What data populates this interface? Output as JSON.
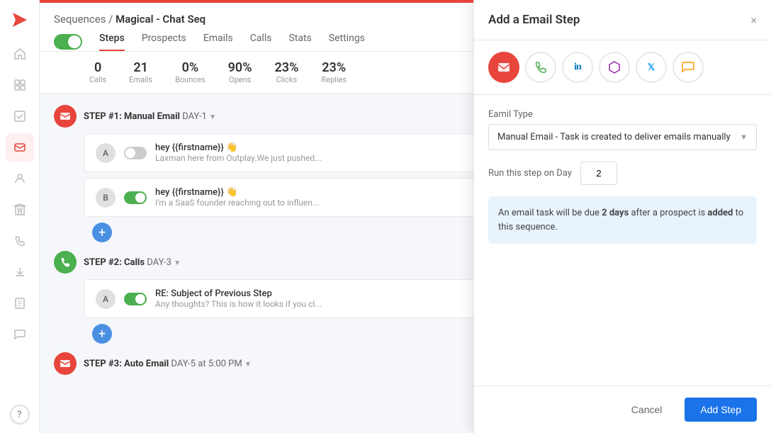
{
  "app": {
    "logo_symbol": "✈"
  },
  "sidebar": {
    "items": [
      {
        "id": "home",
        "icon": "⌂",
        "active": false
      },
      {
        "id": "dashboard",
        "icon": "▦",
        "active": false
      },
      {
        "id": "tasks",
        "icon": "☑",
        "active": false
      },
      {
        "id": "email",
        "icon": "✉",
        "active": true
      },
      {
        "id": "users",
        "icon": "👤",
        "active": false
      },
      {
        "id": "building",
        "icon": "🏢",
        "active": false
      },
      {
        "id": "phone",
        "icon": "☎",
        "active": false
      },
      {
        "id": "download",
        "icon": "⬇",
        "active": false
      },
      {
        "id": "document",
        "icon": "📄",
        "active": false
      },
      {
        "id": "chat",
        "icon": "💬",
        "active": false
      },
      {
        "id": "help",
        "icon": "?",
        "active": false
      }
    ]
  },
  "header": {
    "breadcrumb_prefix": "Sequences /",
    "breadcrumb_bold": "Magical - Chat Seq",
    "toggle_on": true
  },
  "tabs": [
    {
      "id": "steps",
      "label": "Steps",
      "active": true
    },
    {
      "id": "prospects",
      "label": "Prospects",
      "active": false
    },
    {
      "id": "emails",
      "label": "Emails",
      "active": false
    },
    {
      "id": "calls",
      "label": "Calls",
      "active": false
    },
    {
      "id": "stats",
      "label": "Stats",
      "active": false
    },
    {
      "id": "settings",
      "label": "Settings",
      "active": false
    }
  ],
  "stats": [
    {
      "value": "0",
      "label": "Calls"
    },
    {
      "value": "21",
      "label": "Emails"
    },
    {
      "value": "0%",
      "label": "Bounces"
    },
    {
      "value": "90%",
      "label": "Opens"
    },
    {
      "value": "23%",
      "label": "Clicks"
    },
    {
      "value": "23%",
      "label": "Replies"
    }
  ],
  "steps": [
    {
      "id": "step1",
      "label": "STEP #1:",
      "type": "Manual Email",
      "day": "DAY-1",
      "icon_type": "email",
      "emails": [
        {
          "id": "a",
          "avatar": "A",
          "toggle": "off",
          "subject": "hey {{firstname}} 👋",
          "preview": "Laxman here from Outplay.We just pushed..."
        },
        {
          "id": "b",
          "avatar": "B",
          "toggle": "on",
          "subject": "hey {{firstname}} 👋",
          "preview": "I'm a SaaS founder reaching out to influen..."
        }
      ]
    },
    {
      "id": "step2",
      "label": "STEP #2:",
      "type": "Calls",
      "day": "DAY-3",
      "icon_type": "calls",
      "emails": [
        {
          "id": "a",
          "avatar": "A",
          "toggle": "on",
          "subject": "RE: Subject of Previous Step",
          "preview": "Any thoughts? This is how it looks if you cl..."
        }
      ]
    },
    {
      "id": "step3",
      "label": "STEP #3:",
      "type": "Auto Email",
      "day": "DAY-5 at 5:00 PM",
      "icon_type": "email",
      "emails": []
    }
  ],
  "panel": {
    "title": "Add a Email Step",
    "close_icon": "×",
    "icons": [
      {
        "id": "email",
        "type": "red",
        "symbol": "✉"
      },
      {
        "id": "phone",
        "type": "green",
        "symbol": "☎"
      },
      {
        "id": "linkedin",
        "type": "linkedin",
        "symbol": "in"
      },
      {
        "id": "custom",
        "type": "purple",
        "symbol": "⬡"
      },
      {
        "id": "twitter",
        "type": "twitter",
        "symbol": "𝕏"
      },
      {
        "id": "message",
        "type": "yellow",
        "symbol": "💬"
      }
    ],
    "email_type_label": "Eamil Type",
    "email_type_value": "Manual Email - Task is created to deliver emails manually",
    "run_day_label": "Run this step on Day",
    "run_day_value": "2",
    "info_text_prefix": "An email task will be due ",
    "info_text_bold1": "2 days",
    "info_text_mid": " after a prospect is ",
    "info_text_bold2": "added",
    "info_text_suffix": " to this sequence.",
    "cancel_label": "Cancel",
    "add_label": "Add Step"
  }
}
